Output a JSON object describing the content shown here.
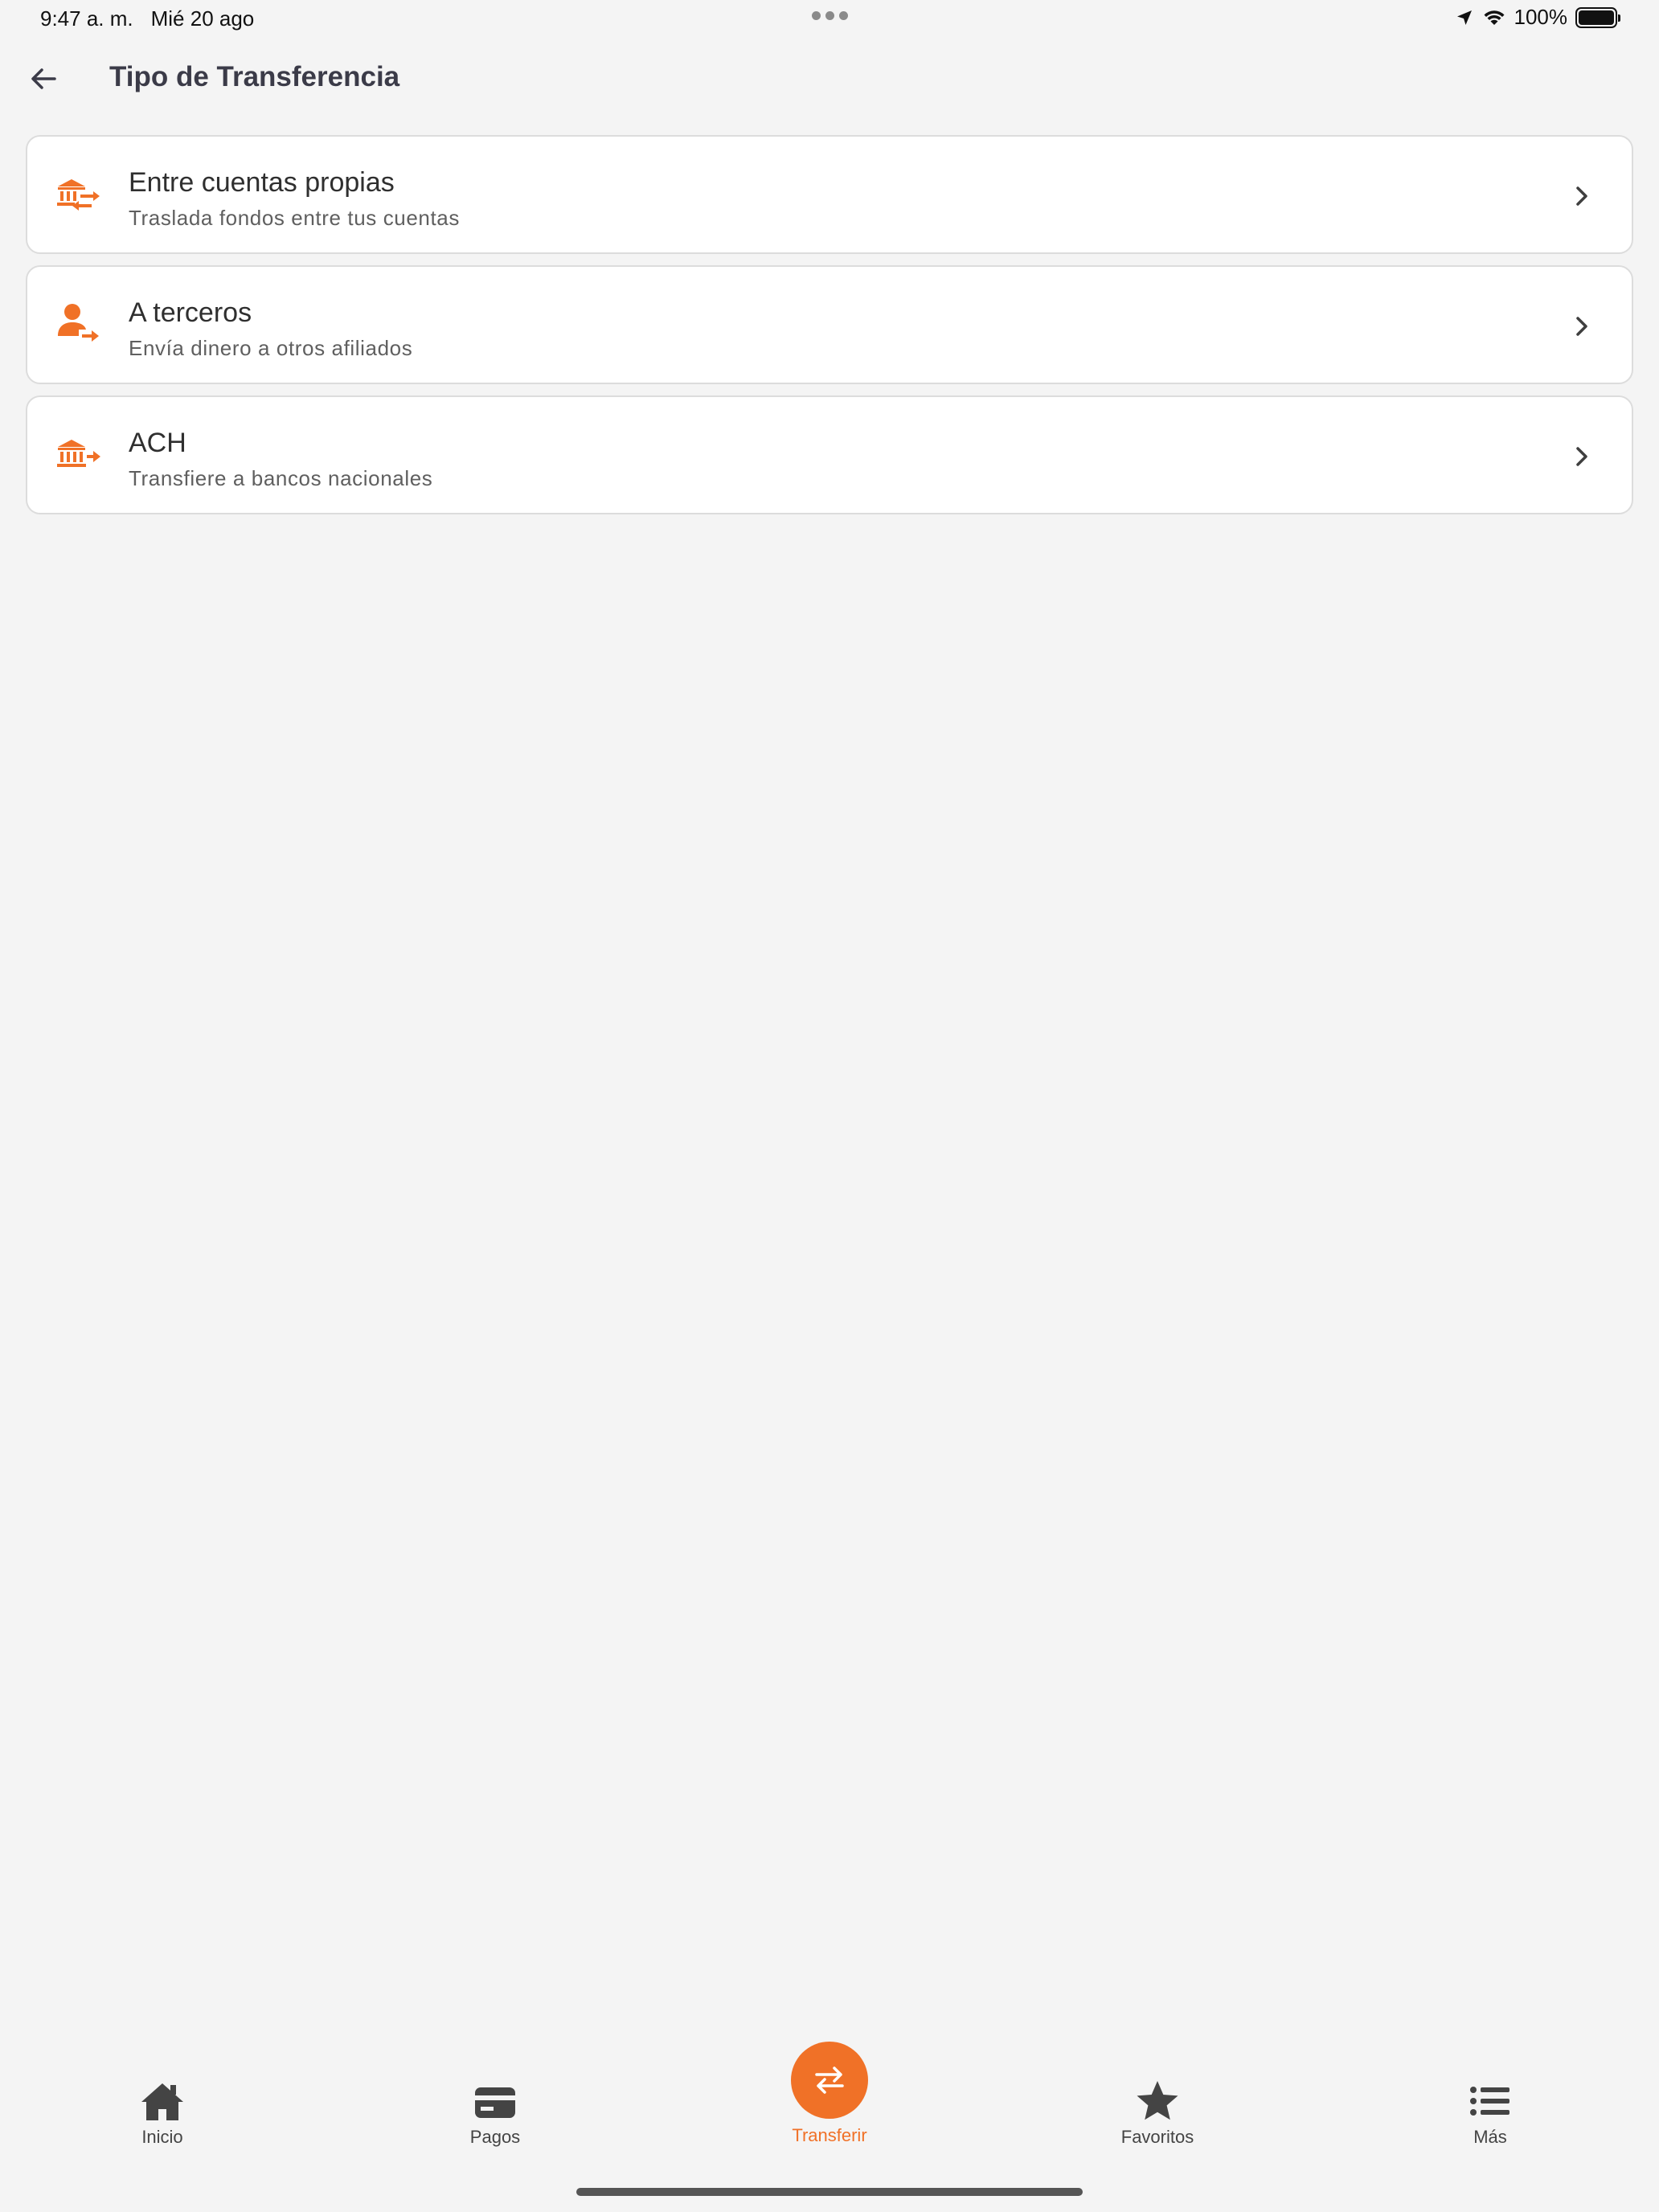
{
  "status_bar": {
    "time": "9:47 a. m.",
    "date": "Mié 20 ago",
    "battery": "100%"
  },
  "header": {
    "title": "Tipo de Transferencia"
  },
  "options": [
    {
      "title": "Entre cuentas propias",
      "subtitle": "Traslada fondos entre tus cuentas",
      "icon": "bank-exchange-icon"
    },
    {
      "title": "A terceros",
      "subtitle": "Envía dinero a otros afiliados",
      "icon": "person-send-icon"
    },
    {
      "title": "ACH",
      "subtitle": "Transfiere a bancos nacionales",
      "icon": "bank-send-icon"
    }
  ],
  "nav": {
    "inicio": "Inicio",
    "pagos": "Pagos",
    "transferir": "Transferir",
    "favoritos": "Favoritos",
    "mas": "Más"
  },
  "colors": {
    "accent": "#f07127",
    "background": "#f4f4f4",
    "card": "#ffffff",
    "title": "#3b3b48"
  }
}
